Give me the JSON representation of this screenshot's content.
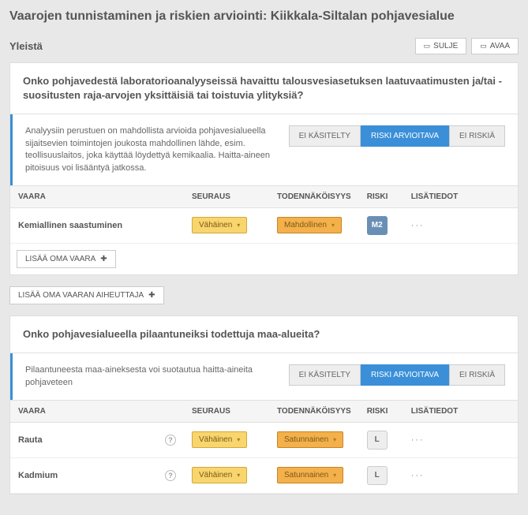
{
  "page": {
    "title": "Vaarojen tunnistaminen ja riskien arviointi: Kiikkala-Siltalan pohjavesialue",
    "section": "Yleistä",
    "btn_close": "SULJE",
    "btn_open": "AVAA"
  },
  "status": {
    "not_handled": "EI KÄSITELTY",
    "risk_assess": "RISKI ARVIOITAVA",
    "no_risk": "EI RISKIÄ"
  },
  "cols": {
    "vaara": "VAARA",
    "seuraus": "SEURAUS",
    "toden": "TODENNÄKÖISYYS",
    "riski": "RISKI",
    "lisatiedot": "LISÄTIEDOT"
  },
  "add_own_vaara": "LISÄÄ OMA VAARA",
  "add_own_aiheuttaja": "LISÄÄ OMA VAARAN AIHEUTTAJA",
  "q1": {
    "title": "Onko pohjavedestä laboratorioanalyyseissä havaittu talousvesiasetuksen laatuvaatimusten ja/tai -suositusten raja-arvojen yksittäisiä tai toistuvia ylityksiä?",
    "help": "Analyysiin perustuen on mahdollista arvioida pohjavesialueella sijaitsevien toimintojen joukosta mahdollinen lähde, esim. teollisuuslaitos, joka käyttää löydettyä kemikaalia. Haitta-aineen pitoisuus voi lisääntyä jatkossa.",
    "rows": [
      {
        "vaara": "Kemiallinen saastuminen",
        "seuraus": "Vähäinen",
        "toden": "Mahdollinen",
        "riski": "M2",
        "riskClass": "m2",
        "help": false
      }
    ]
  },
  "q2": {
    "title": "Onko pohjavesialueella pilaantuneiksi todettuja maa-alueita?",
    "help": "Pilaantuneesta maa-aineksesta voi suotautua haitta-aineita pohjaveteen",
    "rows": [
      {
        "vaara": "Rauta",
        "seuraus": "Vähäinen",
        "toden": "Satunnainen",
        "riski": "L",
        "riskClass": "",
        "help": true
      },
      {
        "vaara": "Kadmium",
        "seuraus": "Vähäinen",
        "toden": "Satunnainen",
        "riski": "L",
        "riskClass": "",
        "help": true
      }
    ]
  }
}
